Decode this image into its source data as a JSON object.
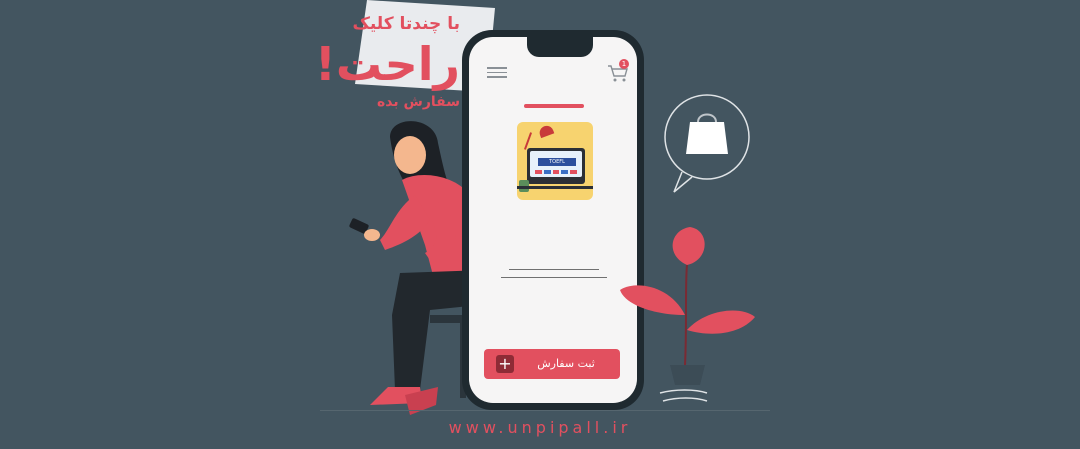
{
  "headline": {
    "line1": "با چندتا کلیک",
    "line2": "راحت!",
    "line3": "سفارش بده"
  },
  "phone": {
    "cart_count": "1",
    "product_screen_label": "TOEFL",
    "order_button_label": "ثبت سفارش",
    "order_button_plus": "+"
  },
  "footer": {
    "url": "www.unpipall.ir"
  },
  "colors": {
    "background": "#435560",
    "accent": "#e2505f"
  }
}
